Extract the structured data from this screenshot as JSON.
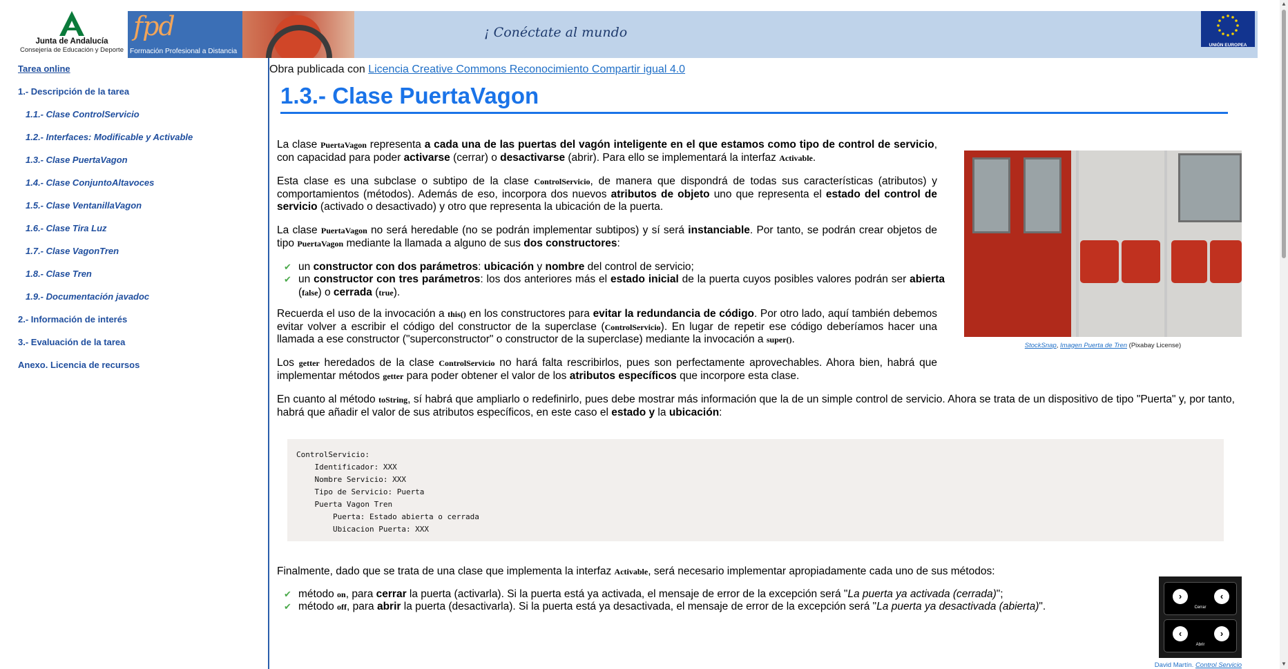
{
  "header": {
    "org_name": "Junta de Andalucía",
    "org_dept": "Consejería de Educación y Deporte",
    "fpd_logo": "fpd",
    "fpd_text": "Formación Profesional a Distancia",
    "slogan": "¡ Conéctate al mundo",
    "eu_label": "UNIÓN EUROPEA"
  },
  "sidebar": {
    "items": [
      {
        "label": "Tarea online"
      },
      {
        "label": "1.- Descripción de la tarea"
      },
      {
        "label": "1.1.- Clase ControlServicio"
      },
      {
        "label": "1.2.- Interfaces: Modificable y Activable"
      },
      {
        "label": "1.3.- Clase PuertaVagon"
      },
      {
        "label": "1.4.- Clase ConjuntoAltavoces"
      },
      {
        "label": "1.5.- Clase VentanillaVagon"
      },
      {
        "label": "1.6.- Clase Tira Luz"
      },
      {
        "label": "1.7.- Clase VagonTren"
      },
      {
        "label": "1.8.- Clase Tren"
      },
      {
        "label": "1.9.- Documentación javadoc"
      },
      {
        "label": "2.- Información de interés"
      },
      {
        "label": "3.- Evaluación de la tarea"
      },
      {
        "label": "Anexo. Licencia de recursos"
      }
    ]
  },
  "license": {
    "prefix": "Obra publicada con ",
    "link": "Licencia Creative Commons Reconocimiento Compartir igual 4.0"
  },
  "title": "1.3.- Clase PuertaVagon",
  "paragraphs": {
    "p1": [
      "La clase ",
      "PuertaVagon",
      " representa ",
      "a cada una de las puertas del vagón inteligente en el que estamos como tipo de control de servicio",
      ", con capacidad para poder ",
      "activarse",
      " (cerrar) o ",
      "desactivarse",
      " (abrir). Para ello se implementará la interfaz ",
      "Activable",
      "."
    ],
    "p2": [
      "Esta clase es una subclase o subtipo de la clase ",
      "ControlServicio",
      ", de manera que dispondrá de todas sus características (atributos) y comportamientos (métodos). Además de eso, incorpora dos nuevos ",
      "atributos de objeto",
      " uno que representa el ",
      "estado del control de servicio",
      " (activado o desactivado)  y otro que representa la ubicación de la puerta."
    ],
    "p3": [
      "La clase ",
      "PuertaVagon",
      " no será heredable (no se podrán implementar subtipos) y sí será ",
      "instanciable",
      ". Por tanto, se podrán crear objetos de tipo ",
      "PuertaVagon",
      " mediante la llamada a alguno de sus ",
      "dos constructores",
      ":"
    ],
    "b1": [
      "un ",
      "constructor con dos parámetros",
      ":  ",
      "ubicación",
      " y ",
      "nombre",
      " del control de servicio;"
    ],
    "b2": [
      "un ",
      "constructor con tres parámetros",
      ": los dos anteriores más el ",
      "estado inicial",
      " de la puerta cuyos posibles valores podrán ser ",
      "abierta",
      " (",
      "false",
      ") o ",
      "cerrada",
      " (",
      "true",
      ")."
    ],
    "p4": [
      "Recuerda el uso de la invocación a ",
      "this()",
      " en los constructores para ",
      "evitar la redundancia de código",
      ". Por otro lado, aquí también debemos evitar volver a escribir el código del constructor de la superclase (",
      "ControlServicio",
      "). En lugar de repetir ese código deberíamos hacer una llamada a ese constructor (\"superconstructor\" o constructor de la superclase) mediante la invocación a ",
      "super()",
      "."
    ],
    "p5": [
      "Los ",
      "getter",
      " heredados de la clase ",
      "ControlServicio",
      " no hará falta rescribirlos, pues son perfectamente aprovechables. Ahora bien, habrá que implementar métodos ",
      "getter",
      " para poder obtener el valor de los ",
      "atributos específicos",
      " que incorpore esta clase."
    ],
    "p6": [
      "En cuanto al método ",
      "toString",
      ", sí habrá que ampliarlo o redefinirlo, pues debe mostrar más información que la de un simple control de servicio. Ahora se trata de un dispositivo de tipo \"Puerta\" y, por tanto, habrá que añadir el valor de sus atributos específicos, en este caso el ",
      "estado y",
      " la ",
      "ubicación",
      ":"
    ],
    "p7": [
      "Finalmente, dado que se trata de una clase que implementa la interfaz ",
      "Activable",
      ", será necesario implementar apropiadamente cada uno de sus métodos:"
    ],
    "b3": [
      "método ",
      "on",
      ", para ",
      "cerrar",
      " la puerta (activarla). Si la puerta está ya activada, el mensaje de error de la excepción será \"",
      "La puerta ya activada (cerrada)",
      "\";"
    ],
    "b4": [
      "método ",
      "off",
      ", para ",
      "abrir",
      " la puerta (desactivarla). Si la puerta está ya desactivada, el mensaje de error de la excepción será \"",
      "La puerta ya desactivada (abierta)",
      "\"."
    ]
  },
  "code_block": "ControlServicio:\n    Identificador: XXX\n    Nombre Servicio: XXX\n    Tipo de Servicio: Puerta\n    Puerta Vagon Tren\n        Puerta: Estado abierta o cerrada\n        Ubicacion Puerta: XXX",
  "image_caption": {
    "author": "StockSnap",
    "title": "Imagen Puerta de Tren",
    "license": " (Pixabay License)"
  },
  "widget": {
    "btn_right": "›",
    "btn_left": "‹",
    "label_top": "Cerrar",
    "label_bottom": "Abrir",
    "caption_author": "David Martín. ",
    "caption_title": "Control Servicio"
  },
  "colors": {
    "accent": "#1a73e8",
    "sidebar_link": "#1f4e9e",
    "link": "#1f6fc7",
    "code_bg": "#f2efed"
  }
}
